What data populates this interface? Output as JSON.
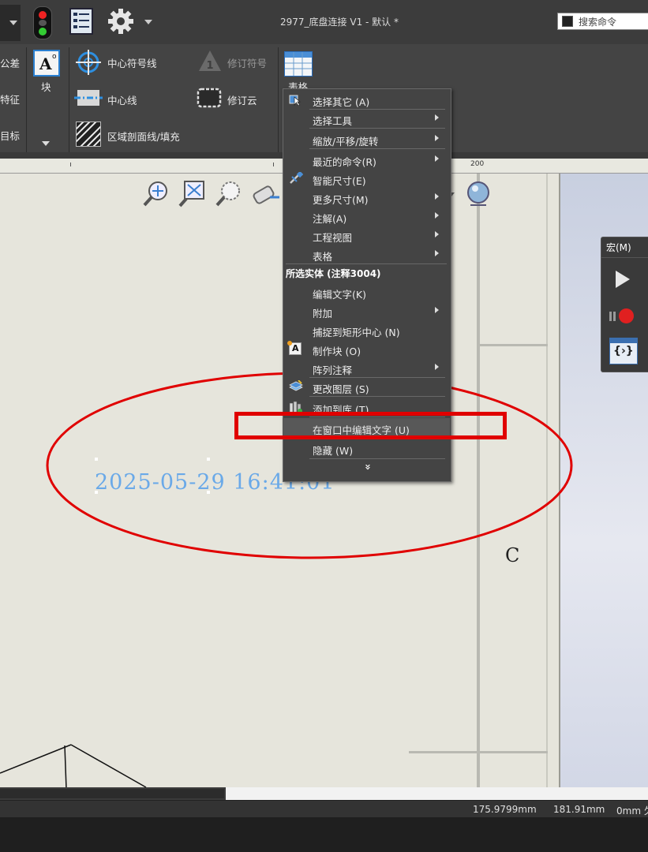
{
  "window": {
    "title": "2977_底盘连接 V1 - 默认 *",
    "search_placeholder": "搜索命令"
  },
  "ribbon": {
    "partial_left_labels": [
      "公差",
      "特征",
      "目标"
    ],
    "block_label": "块",
    "items": {
      "center_mark": "中心符号线",
      "centerline": "中心线",
      "hatch": "区域剖面线/填充",
      "revision_symbol": "修订符号",
      "revision_cloud": "修订云",
      "table": "表格"
    }
  },
  "ruler": {
    "tick_label": "200"
  },
  "context_menu": {
    "items_top": [
      {
        "label": "选择其它 (A)",
        "submenu": false
      },
      {
        "label": "选择工具",
        "submenu": true
      },
      {
        "label": "缩放/平移/旋转",
        "submenu": true
      },
      {
        "label": "最近的命令(R)",
        "submenu": true
      },
      {
        "label": "智能尺寸(E)",
        "submenu": false
      },
      {
        "label": "更多尺寸(M)",
        "submenu": true
      },
      {
        "label": "注解(A)",
        "submenu": true
      },
      {
        "label": "工程视图",
        "submenu": true
      },
      {
        "label": "表格",
        "submenu": true
      }
    ],
    "section_header": "所选实体 (注释3004)",
    "items_bottom": [
      {
        "label": "编辑文字(K)",
        "submenu": false
      },
      {
        "label": "附加",
        "submenu": true
      },
      {
        "label": "捕捉到矩形中心 (N)",
        "submenu": false
      },
      {
        "label": "制作块 (O)",
        "submenu": false
      },
      {
        "label": "阵列注释",
        "submenu": true
      },
      {
        "label": "更改图层 (S)",
        "submenu": false
      },
      {
        "label": "添加到库 (T)",
        "submenu": false
      },
      {
        "label": "在窗口中编辑文字 (U)",
        "submenu": false
      },
      {
        "label": "隐藏 (W)",
        "submenu": false
      }
    ],
    "expand_glyph": "»"
  },
  "drawing": {
    "timestamp_note": "2025-05-29 16:41:01",
    "zone_letter": "C"
  },
  "macro_panel": {
    "title": "宏(M)"
  },
  "status_bar": {
    "x_coord": "175.9799mm",
    "y_coord": "181.91mm",
    "z_coord": "0mm 欠"
  },
  "colors": {
    "annotation_red": "#e00000",
    "note_text_blue": "#6aa9e8"
  }
}
